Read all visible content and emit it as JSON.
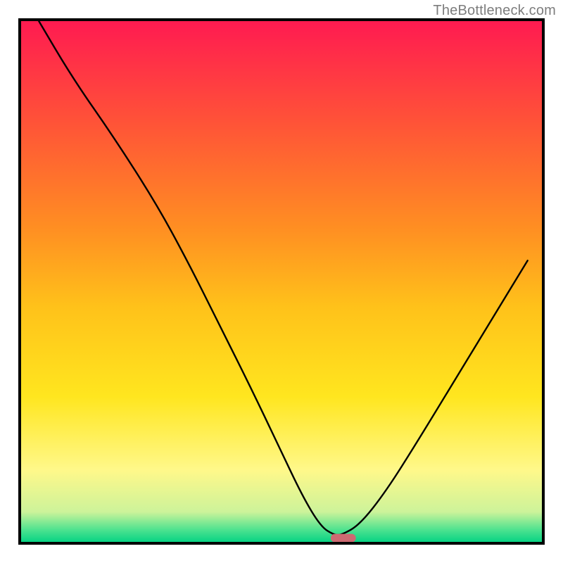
{
  "attribution": "TheBottleneck.com",
  "chart_data": {
    "type": "line",
    "title": "",
    "xlabel": "",
    "ylabel": "",
    "xlim": [
      0,
      100
    ],
    "ylim": [
      0,
      100
    ],
    "grid": false,
    "legend": false,
    "background_gradient_stops": [
      {
        "offset": 0.0,
        "color": "#ff1a51"
      },
      {
        "offset": 0.2,
        "color": "#ff5437"
      },
      {
        "offset": 0.4,
        "color": "#ff8f22"
      },
      {
        "offset": 0.55,
        "color": "#ffc21a"
      },
      {
        "offset": 0.72,
        "color": "#ffe61f"
      },
      {
        "offset": 0.86,
        "color": "#fff88a"
      },
      {
        "offset": 0.94,
        "color": "#cdf39a"
      },
      {
        "offset": 0.975,
        "color": "#4be28f"
      },
      {
        "offset": 1.0,
        "color": "#00d183"
      }
    ],
    "series": [
      {
        "name": "bottleneck-curve",
        "color": "#000000",
        "width": 2.4,
        "x": [
          3.5,
          10,
          18,
          26,
          32,
          38,
          44,
          49.5,
          54,
          57.5,
          60,
          61.5,
          65,
          70,
          76,
          83,
          90,
          97
        ],
        "y": [
          100,
          89,
          77.5,
          65,
          54,
          42,
          30,
          18.5,
          9,
          3.2,
          1.6,
          1.6,
          3.6,
          10,
          19.5,
          31,
          42.5,
          54
        ]
      }
    ],
    "marker": {
      "name": "minimum-marker",
      "x": 61.8,
      "y": 1.0,
      "width": 4.8,
      "height": 1.6,
      "rx": 0.9,
      "color": "#cd6a72"
    }
  }
}
